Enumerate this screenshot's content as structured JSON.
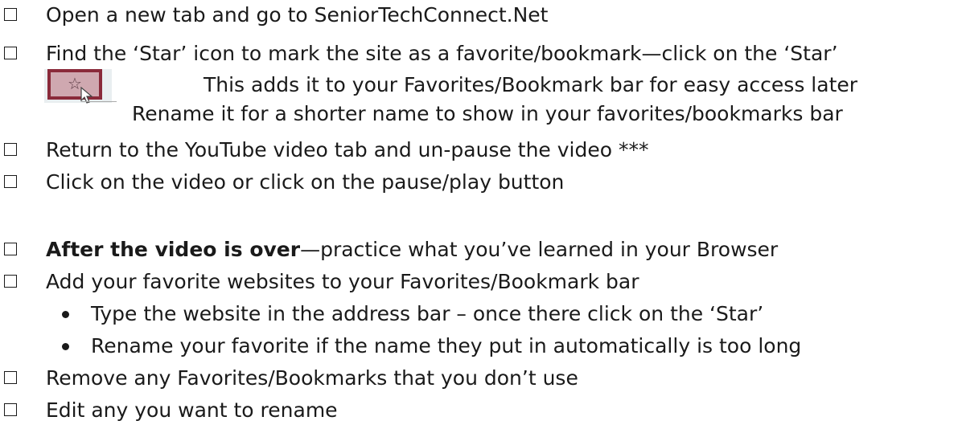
{
  "items": [
    {
      "id": "open-tab",
      "text": "Open a new tab and go to SeniorTechConnect.Net"
    },
    {
      "id": "find-star",
      "text": "Find the ‘Star’ icon to mark the site as a favorite/bookmark—click on the ‘Star’"
    },
    {
      "id": "adds-it",
      "text": "This adds it to your Favorites/Bookmark bar for easy access later"
    },
    {
      "id": "rename-it",
      "text": "Rename it for a shorter name to show in your favorites/bookmarks bar"
    },
    {
      "id": "return-video",
      "text": "Return to the YouTube video tab and un-pause the video ***"
    },
    {
      "id": "click-video",
      "text": "Click on the video or click on the pause/play button"
    },
    {
      "id": "after-video-bold",
      "text": "After the video is over"
    },
    {
      "id": "after-video-rest",
      "text": "—practice what you’ve learned in your Browser"
    },
    {
      "id": "add-favorites",
      "text": "Add your favorite websites to your Favorites/Bookmark bar"
    },
    {
      "id": "bullet-type",
      "text": "Type the website in the address bar – once there click on the ‘Star’"
    },
    {
      "id": "bullet-rename",
      "text": "Rename your favorite if the name they put in automatically is too long"
    },
    {
      "id": "remove",
      "text": "Remove any Favorites/Bookmarks that you don’t use"
    },
    {
      "id": "edit",
      "text": "Edit any you want to rename"
    }
  ],
  "icons": {
    "checkbox": "empty-checkbox-icon",
    "star": "star-bookmark-icon",
    "cursor": "mouse-pointer-icon",
    "bullet": "bullet-dot-icon"
  },
  "colors": {
    "text": "#1a1a1a",
    "star_border": "#8a2a3a",
    "star_fill": "#cfa8b0"
  }
}
